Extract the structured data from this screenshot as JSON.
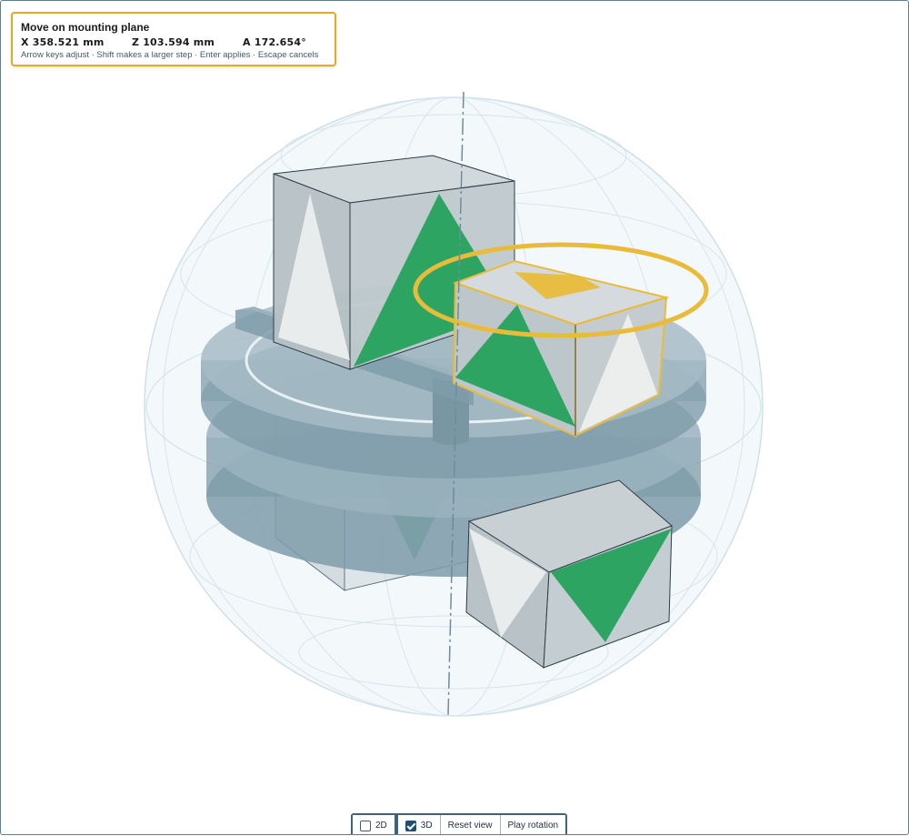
{
  "hud": {
    "title": "Move on mounting plane",
    "x_value": "X 358.521 mm",
    "z_value": "Z 103.594 mm",
    "a_value": "A 172.654°",
    "hint": "Arrow keys adjust · Shift makes a larger step · Enter applies · Escape cancels"
  },
  "toolbar": {
    "mode_2d_label": "2D",
    "mode_2d_checked": false,
    "mode_3d_label": "3D",
    "mode_3d_checked": true,
    "reset_view_label": "Reset view",
    "play_rotation_label": "Play rotation"
  },
  "colors": {
    "accent": "#e8a91c",
    "selection_ring": "#e8bc3a",
    "green_face": "#2ea462",
    "box_face": "#c6ccd1",
    "turntable": "#7b98a5"
  }
}
